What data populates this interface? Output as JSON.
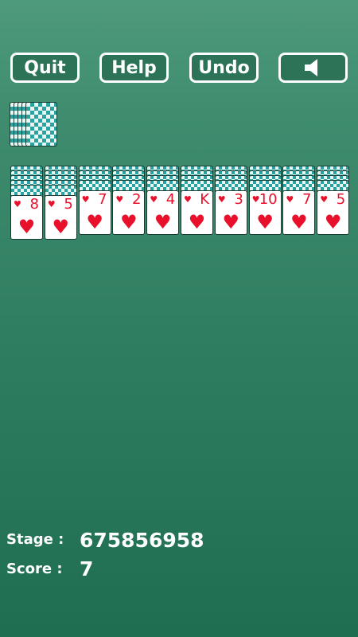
{
  "toolbar": {
    "quit_label": "Quit",
    "help_label": "Help",
    "undo_label": "Undo",
    "sound_icon": "speaker-icon"
  },
  "stock": {
    "deals_remaining": 5
  },
  "tableau": [
    {
      "hidden": 5,
      "rank": "8",
      "suit": "♥"
    },
    {
      "hidden": 5,
      "rank": "5",
      "suit": "♥"
    },
    {
      "hidden": 4,
      "rank": "7",
      "suit": "♥"
    },
    {
      "hidden": 4,
      "rank": "2",
      "suit": "♥"
    },
    {
      "hidden": 4,
      "rank": "4",
      "suit": "♥"
    },
    {
      "hidden": 4,
      "rank": "K",
      "suit": "♥"
    },
    {
      "hidden": 4,
      "rank": "3",
      "suit": "♥"
    },
    {
      "hidden": 4,
      "rank": "10",
      "suit": "♥"
    },
    {
      "hidden": 4,
      "rank": "7",
      "suit": "♥"
    },
    {
      "hidden": 4,
      "rank": "5",
      "suit": "♥"
    }
  ],
  "status": {
    "stage_label": "Stage :",
    "stage_value": "675856958",
    "score_label": "Score :",
    "score_value": "7"
  },
  "colors": {
    "background_top": "#4f9a7c",
    "background_bottom": "#1f6e52",
    "card_back_pattern": "#2aa3a0",
    "suit_red": "#e8102a"
  }
}
